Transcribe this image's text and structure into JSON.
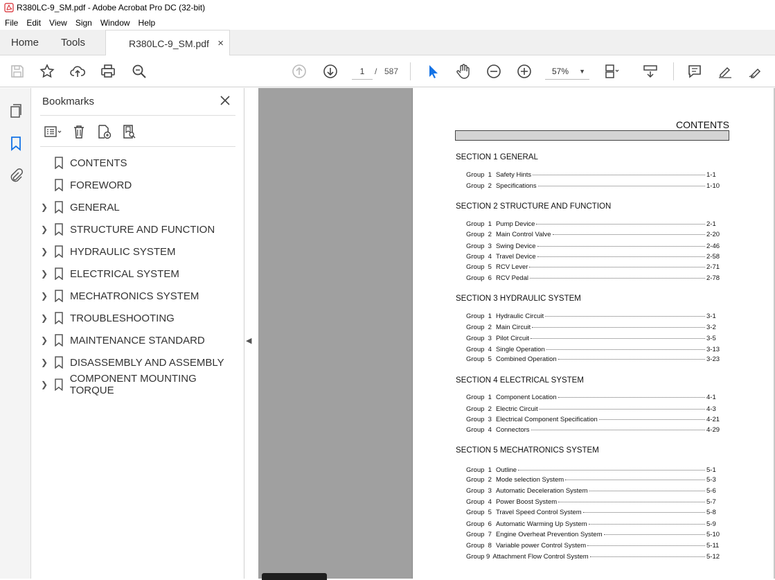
{
  "window": {
    "title": "R380LC-9_SM.pdf - Adobe Acrobat Pro DC (32-bit)"
  },
  "menu": [
    "File",
    "Edit",
    "View",
    "Sign",
    "Window",
    "Help"
  ],
  "tabs": {
    "home": "Home",
    "tools": "Tools",
    "doc": "R380LC-9_SM.pdf",
    "close": "×"
  },
  "nav": {
    "page": "1",
    "sep": "/",
    "total": "587"
  },
  "zoom": {
    "value": "57%"
  },
  "bookmarks": {
    "title": "Bookmarks",
    "items": [
      {
        "label": "CONTENTS",
        "expandable": false
      },
      {
        "label": "FOREWORD",
        "expandable": false
      },
      {
        "label": "GENERAL",
        "expandable": true
      },
      {
        "label": "STRUCTURE AND FUNCTION",
        "expandable": true
      },
      {
        "label": "HYDRAULIC SYSTEM",
        "expandable": true
      },
      {
        "label": "ELECTRICAL SYSTEM",
        "expandable": true
      },
      {
        "label": "MECHATRONICS SYSTEM",
        "expandable": true
      },
      {
        "label": "TROUBLESHOOTING",
        "expandable": true
      },
      {
        "label": "MAINTENANCE STANDARD",
        "expandable": true
      },
      {
        "label": "DISASSEMBLY AND ASSEMBLY",
        "expandable": true
      },
      {
        "label": "COMPONENT MOUNTING TORQUE",
        "expandable": true
      }
    ]
  },
  "doc": {
    "title": "CONTENTS",
    "sections": [
      {
        "heading": "SECTION 1  GENERAL",
        "rows": [
          {
            "group": "Group  1",
            "label": "Safety Hints",
            "page": "1-1"
          },
          {
            "group": "Group  2",
            "label": "Specifications",
            "page": "1-10"
          }
        ]
      },
      {
        "heading": "SECTION 2  STRUCTURE AND FUNCTION",
        "rows": [
          {
            "group": "Group  1",
            "label": "Pump Device",
            "page": "2-1"
          },
          {
            "group": "Group  2",
            "label": "Main Control Valve",
            "page": "2-20"
          },
          {
            "group": "Group  3",
            "label": "Swing Device",
            "page": "2-46"
          },
          {
            "group": "Group  4",
            "label": "Travel Device",
            "page": "2-58"
          },
          {
            "group": "Group  5",
            "label": "RCV Lever",
            "page": "2-71"
          },
          {
            "group": "Group  6",
            "label": "RCV Pedal",
            "page": "2-78"
          }
        ]
      },
      {
        "heading": "SECTION 3  HYDRAULIC SYSTEM",
        "rows": [
          {
            "group": "Group  1",
            "label": "Hydraulic Circuit",
            "page": "3-1"
          },
          {
            "group": "Group  2",
            "label": "Main Circuit",
            "page": "3-2"
          },
          {
            "group": "Group  3",
            "label": "Pilot Circuit",
            "page": "3-5"
          },
          {
            "group": "Group  4",
            "label": "Single Operation",
            "page": "3-13"
          },
          {
            "group": "Group  5",
            "label": "Combined Operation",
            "page": "3-23"
          }
        ]
      },
      {
        "heading": "SECTION 4  ELECTRICAL SYSTEM",
        "rows": [
          {
            "group": "Group  1",
            "label": "Component Location",
            "page": "4-1"
          },
          {
            "group": "Group  2",
            "label": "Electric Circuit",
            "page": "4-3"
          },
          {
            "group": "Group  3",
            "label": "Electrical Component Specification",
            "page": "4-21"
          },
          {
            "group": "Group  4",
            "label": "Connectors",
            "page": "4-29"
          }
        ]
      },
      {
        "heading": "SECTION 5  MECHATRONICS SYSTEM",
        "rows": [
          {
            "group": "Group  1",
            "label": "Outline",
            "page": "5-1"
          },
          {
            "group": "Group  2",
            "label": "Mode selection System",
            "page": "5-3"
          },
          {
            "group": "Group  3",
            "label": "Automatic Deceleration System",
            "page": "5-6"
          },
          {
            "group": "Group  4",
            "label": "Power Boost System",
            "page": "5-7"
          },
          {
            "group": "Group  5",
            "label": "Travel Speed Control System",
            "page": "5-8"
          },
          {
            "group": "Group  6",
            "label": "Automatic Warming Up System",
            "page": "5-9"
          },
          {
            "group": "Group  7",
            "label": "Engine Overheat Prevention System",
            "page": "5-10"
          },
          {
            "group": "Group  8",
            "label": "Variable power Control System",
            "page": "5-11"
          },
          {
            "group": "Group 9",
            "label": "Attachment Flow Control System",
            "page": "5-12"
          }
        ]
      }
    ]
  },
  "colors": {
    "accent": "#1473e6",
    "pdfred": "#d7282f",
    "panel": "#f4f4f4",
    "viewerGray": "#a0a0a0"
  }
}
